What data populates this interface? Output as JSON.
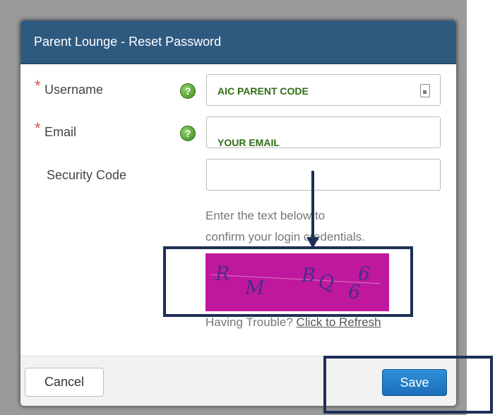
{
  "dialog": {
    "title": "Parent Lounge - Reset Password"
  },
  "form": {
    "username": {
      "label": "Username",
      "required_marker": "*",
      "value": "AIC PARENT CODE"
    },
    "email": {
      "label": "Email",
      "required_marker": "*",
      "value": "YOUR EMAIL"
    },
    "security_code": {
      "label": "Security Code",
      "value": ""
    },
    "help_icon": "help-question-icon",
    "hint_line1": "Enter the text below to",
    "hint_line2": "confirm your login credentials.",
    "captcha_text": [
      "R",
      "M",
      "B",
      "Q",
      "6",
      "6"
    ],
    "trouble_text": "Having Trouble?",
    "refresh_link": "Click to Refresh"
  },
  "footer": {
    "cancel_label": "Cancel",
    "save_label": "Save"
  },
  "colors": {
    "title_bar": "#2e5a80",
    "required": "#d9534f",
    "save_button": "#1a6fb8",
    "captcha_bg": "#c0189d",
    "annotation": "#1d2f56"
  }
}
